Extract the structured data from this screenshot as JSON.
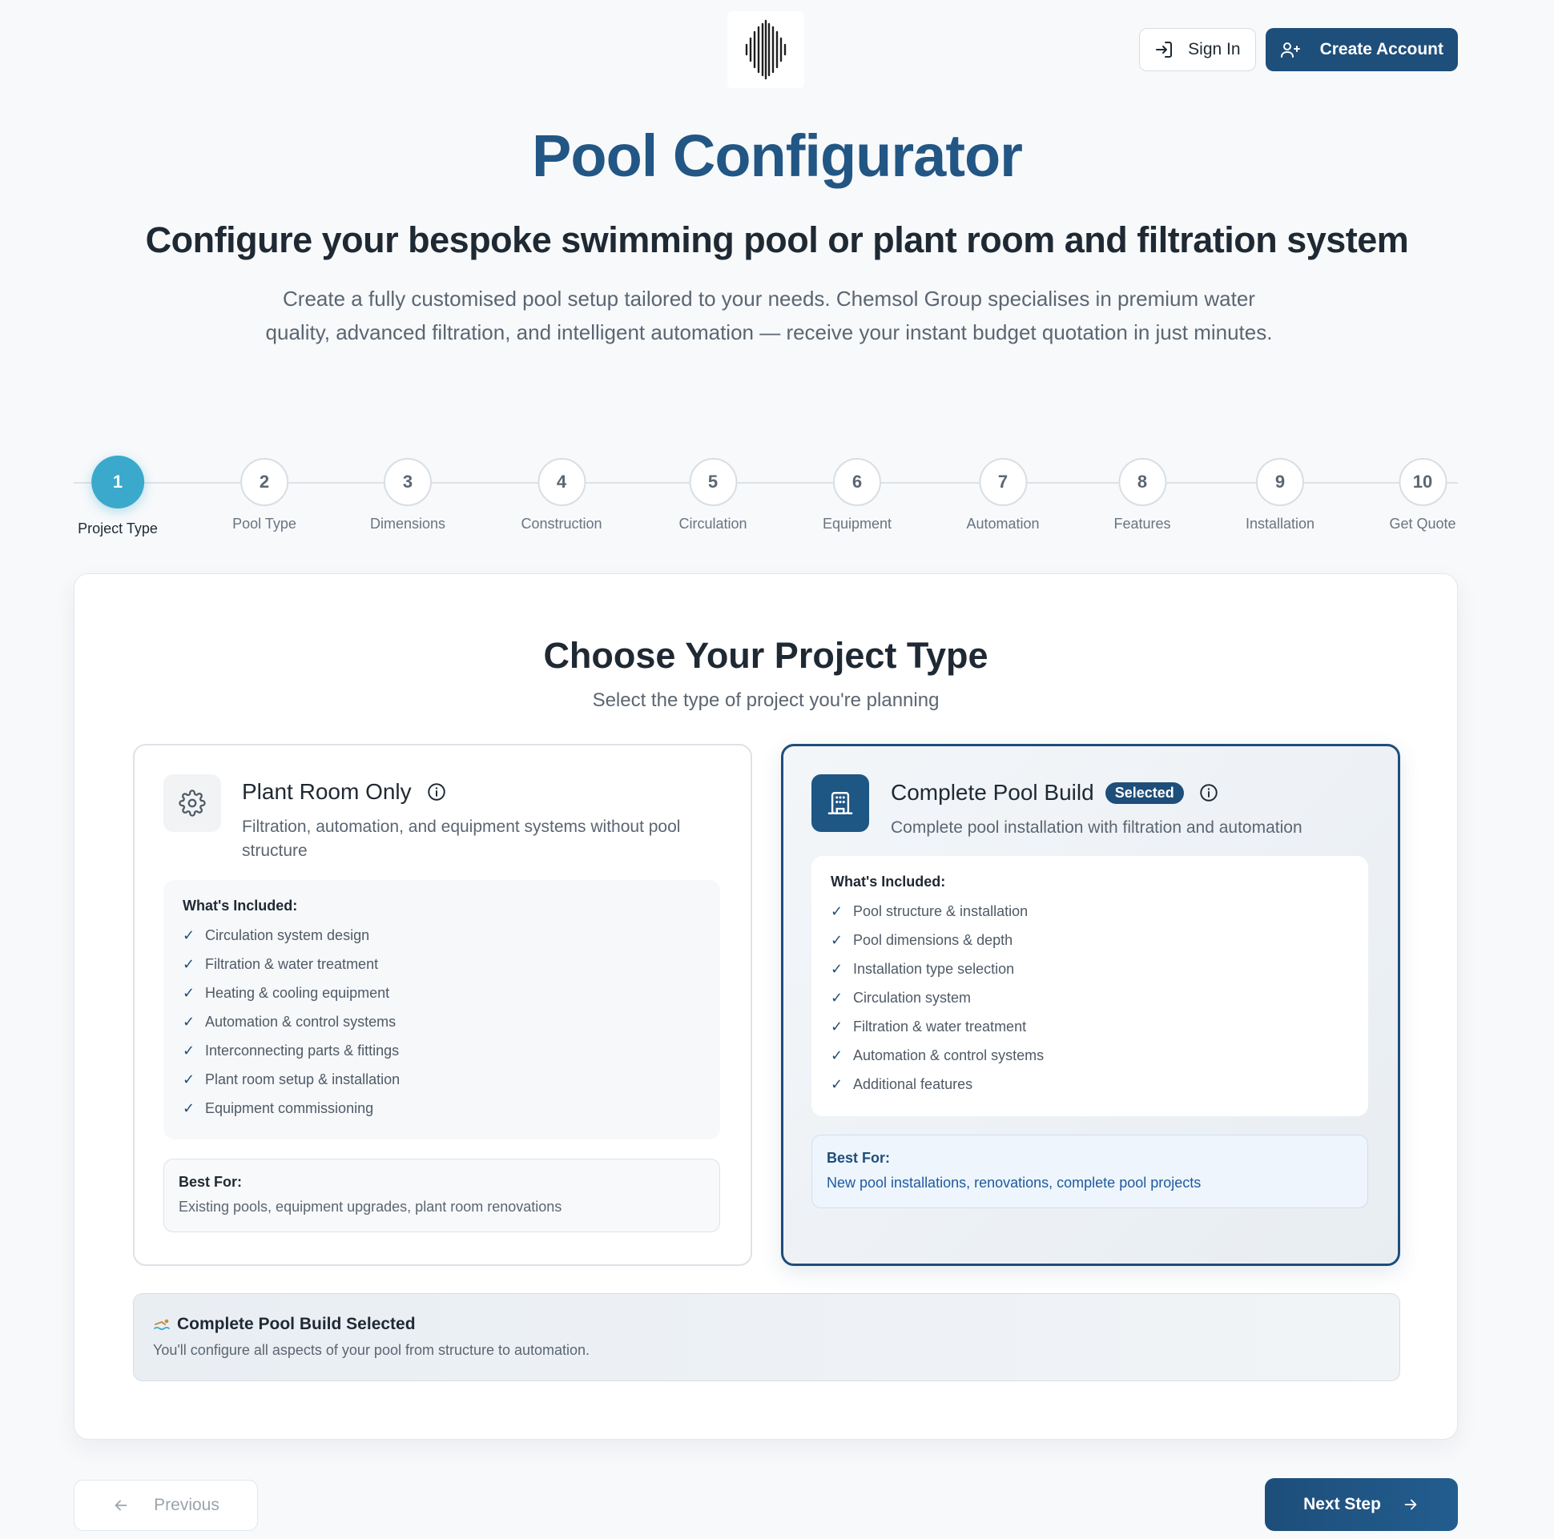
{
  "header": {
    "sign_in_label": "Sign In",
    "create_account_label": "Create Account"
  },
  "hero": {
    "title": "Pool Configurator",
    "subtitle": "Configure your bespoke swimming pool or plant room and filtration system",
    "intro": "Create a fully customised pool setup tailored to your needs. Chemsol Group specialises in premium water quality, advanced filtration, and intelligent automation — receive your instant budget quotation in just minutes."
  },
  "steps": [
    {
      "number": "1",
      "label": "Project Type"
    },
    {
      "number": "2",
      "label": "Pool Type"
    },
    {
      "number": "3",
      "label": "Dimensions"
    },
    {
      "number": "4",
      "label": "Construction"
    },
    {
      "number": "5",
      "label": "Circulation"
    },
    {
      "number": "6",
      "label": "Equipment"
    },
    {
      "number": "7",
      "label": "Automation"
    },
    {
      "number": "8",
      "label": "Features"
    },
    {
      "number": "9",
      "label": "Installation"
    },
    {
      "number": "10",
      "label": "Get Quote"
    }
  ],
  "active_step": 1,
  "section": {
    "title": "Choose Your Project Type",
    "subtitle": "Select the type of project you're planning"
  },
  "options": [
    {
      "title": "Plant Room Only",
      "description": "Filtration, automation, and equipment systems without pool structure",
      "icon": "gear-icon",
      "included_title": "What's Included:",
      "included": [
        "Circulation system design",
        "Filtration & water treatment",
        "Heating & cooling equipment",
        "Automation & control systems",
        "Interconnecting parts & fittings",
        "Plant room setup & installation",
        "Equipment commissioning"
      ],
      "best_for_title": "Best For:",
      "best_for": "Existing pools, equipment upgrades, plant room renovations"
    },
    {
      "title": "Complete Pool Build",
      "badge": "Selected",
      "description": "Complete pool installation with filtration and automation",
      "icon": "building-icon",
      "included_title": "What's Included:",
      "included": [
        "Pool structure & installation",
        "Pool dimensions & depth",
        "Installation type selection",
        "Circulation system",
        "Filtration & water treatment",
        "Automation & control systems",
        "Additional features"
      ],
      "best_for_title": "Best For:",
      "best_for": "New pool installations, renovations, complete pool projects"
    }
  ],
  "selection_note": {
    "title": "Complete Pool Build Selected",
    "text": "You'll configure all aspects of your pool from structure to automation."
  },
  "nav": {
    "previous_label": "Previous",
    "next_label": "Next Step"
  },
  "colors": {
    "brand": "#1e4e7a",
    "active_step": "#3ba9cc",
    "title": "#225684"
  }
}
